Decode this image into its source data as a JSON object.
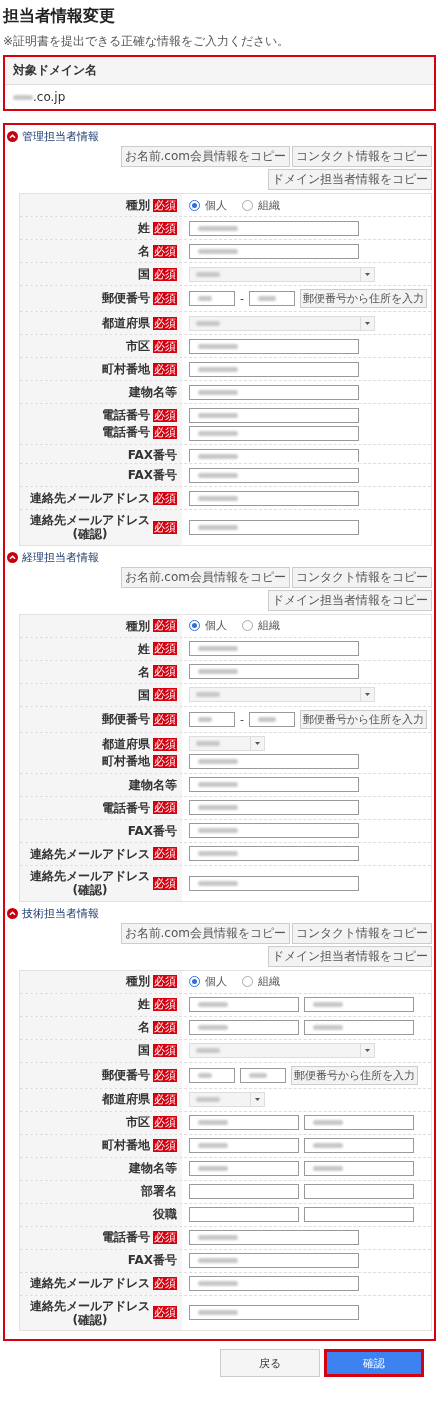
{
  "page": {
    "title": "担当者情報変更",
    "note": "※証明書を提出できる正確な情報をご入力ください。"
  },
  "domain": {
    "highlighted": true,
    "header": "対象ドメイン名",
    "value_suffix": ".co.jp"
  },
  "form_highlighted": true,
  "sections": [
    {
      "title": "管理担当者情報",
      "expanded": true,
      "copy_buttons": [
        "お名前.com会員情報をコピー",
        "コンタクト情報をコピー",
        "ドメイン担当者情報をコピー"
      ],
      "rows": [
        {
          "kind": "radio",
          "label": "種別",
          "badge": "必須",
          "options": [
            {
              "label": "個人",
              "selected": true
            },
            {
              "label": "組織",
              "selected": false
            }
          ]
        },
        {
          "kind": "text",
          "label": "姓",
          "badge": "必須"
        },
        {
          "kind": "text",
          "label": "名",
          "badge": "必須"
        },
        {
          "kind": "select",
          "wide": true,
          "label": "国",
          "badge": "必須"
        },
        {
          "kind": "postal",
          "label": "郵便番号",
          "badge": "必須",
          "separator": "-",
          "button": "郵便番号から住所を入力"
        },
        {
          "kind": "select",
          "wide": true,
          "label": "都道府県",
          "badge": "必須"
        },
        {
          "kind": "text",
          "label": "市区",
          "badge": "必須"
        },
        {
          "kind": "text",
          "label": "町村番地",
          "badge": "必須"
        },
        {
          "kind": "text",
          "label": "建物名等"
        },
        {
          "kind": "stack",
          "items": [
            {
              "kind": "text",
              "label": "電話番号",
              "badge": "必須"
            },
            {
              "kind": "text",
              "label": "電話番号",
              "badge": "必須"
            }
          ]
        },
        {
          "kind": "text",
          "label": "FAX番号",
          "clipped": true
        },
        {
          "kind": "text",
          "label": "FAX番号"
        },
        {
          "kind": "text",
          "label": "連絡先メールアドレス",
          "badge": "必須"
        },
        {
          "kind": "text",
          "label": "連絡先メールアドレス",
          "label_note": "(確認)",
          "badge": "必須"
        }
      ]
    },
    {
      "title": "経理担当者情報",
      "expanded": true,
      "copy_buttons": [
        "お名前.com会員情報をコピー",
        "コンタクト情報をコピー",
        "ドメイン担当者情報をコピー"
      ],
      "rows": [
        {
          "kind": "radio",
          "label": "種別",
          "badge": "必須",
          "options": [
            {
              "label": "個人",
              "selected": true
            },
            {
              "label": "組織",
              "selected": false
            }
          ]
        },
        {
          "kind": "text",
          "label": "姓",
          "badge": "必須"
        },
        {
          "kind": "text",
          "label": "名",
          "badge": "必須"
        },
        {
          "kind": "select",
          "wide": true,
          "label": "国",
          "badge": "必須"
        },
        {
          "kind": "postal",
          "label": "郵便番号",
          "badge": "必須",
          "separator": "-",
          "button": "郵便番号から住所を入力"
        },
        {
          "kind": "stack",
          "items": [
            {
              "kind": "select",
              "wide": false,
              "label": "都道府県",
              "badge": "必須"
            },
            {
              "kind": "text",
              "label": "町村番地",
              "badge": "必須"
            }
          ]
        },
        {
          "kind": "text",
          "label": "建物名等"
        },
        {
          "kind": "text",
          "label": "電話番号",
          "badge": "必須"
        },
        {
          "kind": "text",
          "label": "FAX番号"
        },
        {
          "kind": "text",
          "label": "連絡先メールアドレス",
          "badge": "必須"
        },
        {
          "kind": "text",
          "label": "連絡先メールアドレス",
          "label_note": "(確認)",
          "badge": "必須"
        }
      ]
    },
    {
      "title": "技術担当者情報",
      "expanded": true,
      "copy_buttons": [
        "お名前.com会員情報をコピー",
        "コンタクト情報をコピー",
        "ドメイン担当者情報をコピー"
      ],
      "rows": [
        {
          "kind": "radio",
          "label": "種別",
          "badge": "必須",
          "options": [
            {
              "label": "個人",
              "selected": true
            },
            {
              "label": "組織",
              "selected": false
            }
          ]
        },
        {
          "kind": "pair",
          "label": "姓",
          "badge": "必須",
          "filled": [
            true,
            true
          ]
        },
        {
          "kind": "pair",
          "label": "名",
          "badge": "必須",
          "filled": [
            true,
            true
          ]
        },
        {
          "kind": "select",
          "wide": true,
          "label": "国",
          "badge": "必須"
        },
        {
          "kind": "postal",
          "label": "郵便番号",
          "badge": "必須",
          "button": "郵便番号から住所を入力"
        },
        {
          "kind": "select",
          "wide": false,
          "label": "都道府県",
          "badge": "必須"
        },
        {
          "kind": "pair",
          "label": "市区",
          "badge": "必須",
          "filled": [
            true,
            true
          ]
        },
        {
          "kind": "pair",
          "label": "町村番地",
          "badge": "必須",
          "filled": [
            true,
            true
          ]
        },
        {
          "kind": "pair",
          "label": "建物名等",
          "filled": [
            true,
            true
          ]
        },
        {
          "kind": "pair",
          "label": "部署名",
          "filled": [
            false,
            false
          ]
        },
        {
          "kind": "pair",
          "label": "役職",
          "filled": [
            false,
            false
          ]
        },
        {
          "kind": "text",
          "label": "電話番号",
          "badge": "必須"
        },
        {
          "kind": "text",
          "label": "FAX番号"
        },
        {
          "kind": "text",
          "label": "連絡先メールアドレス",
          "badge": "必須"
        },
        {
          "kind": "text",
          "label": "連絡先メールアドレス",
          "label_note": "(確認)",
          "badge": "必須"
        }
      ]
    }
  ],
  "buttons": [
    {
      "kind": "secondary",
      "label": "戻る",
      "highlighted": false
    },
    {
      "kind": "primary",
      "label": "確認",
      "highlighted": true
    }
  ]
}
